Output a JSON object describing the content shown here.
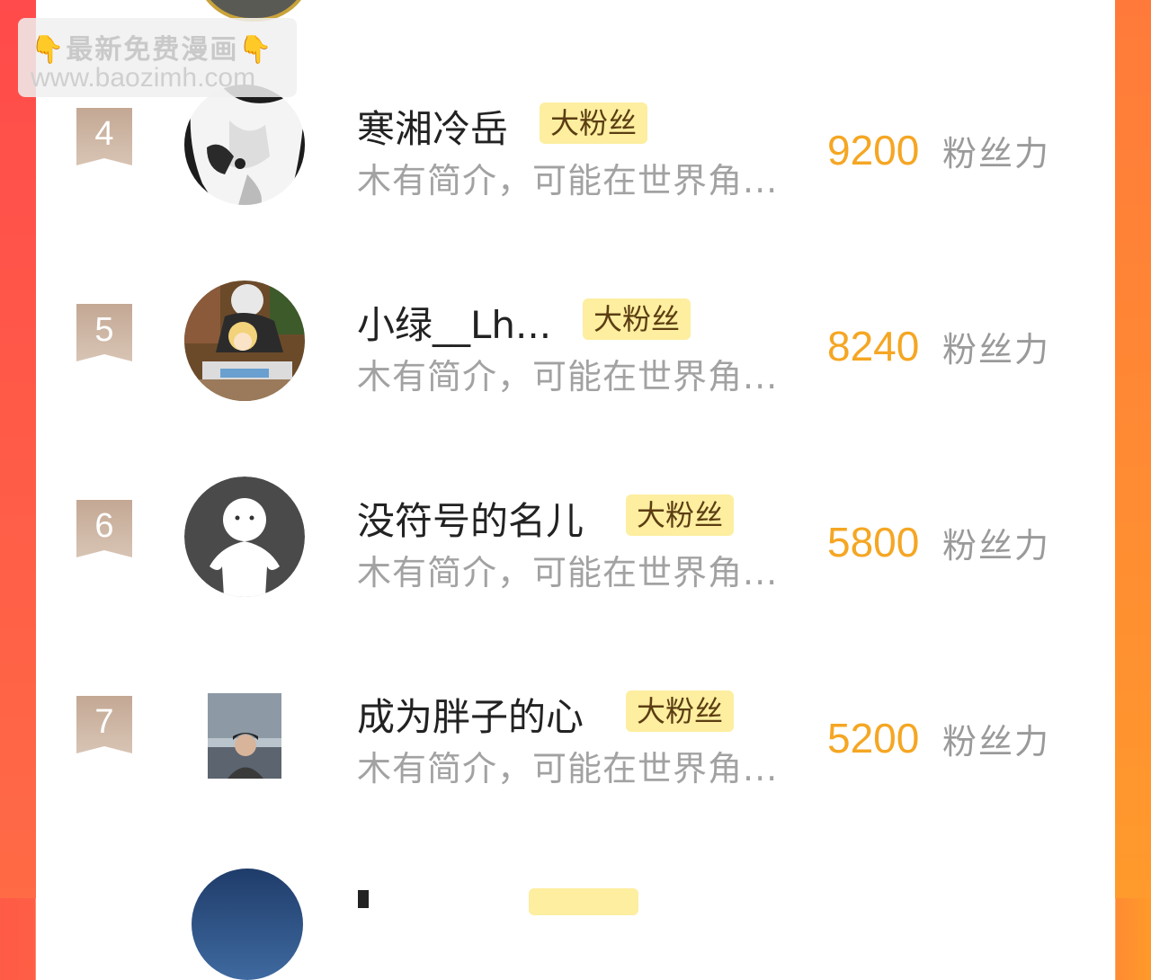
{
  "watermark": {
    "line1": "最新免费漫画",
    "line2": "www.baozimh.com",
    "hand_icon": "👇"
  },
  "colors": {
    "score": "#f5a623",
    "badge_bg": "#fdeea0",
    "rank_badge": "#c8b09c"
  },
  "fans": [
    {
      "rank": "4",
      "name": "寒湘冷岳",
      "badge": "大粉丝",
      "intro": "木有简介，可能在世界角...",
      "score": "9200",
      "unit": "粉丝力",
      "avatar": "manga-girl-bw"
    },
    {
      "rank": "5",
      "name": "小绿__Lh...",
      "badge": "大粉丝",
      "intro": "木有简介，可能在世界角...",
      "score": "8240",
      "unit": "粉丝力",
      "avatar": "anime-duo"
    },
    {
      "rank": "6",
      "name": "没符号的名儿",
      "badge": "大粉丝",
      "intro": "木有简介，可能在世界角...",
      "score": "5800",
      "unit": "粉丝力",
      "avatar": "default-user"
    },
    {
      "rank": "7",
      "name": "成为胖子的心",
      "badge": "大粉丝",
      "intro": "木有简介，可能在世界角...",
      "score": "5200",
      "unit": "粉丝力",
      "avatar": "photo-person"
    }
  ]
}
